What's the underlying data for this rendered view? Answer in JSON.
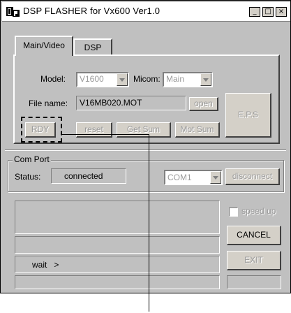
{
  "window": {
    "title": "DSP FLASHER for Vx600   Ver1.0",
    "minimize_glyph": "_",
    "maximize_glyph": "□",
    "close_glyph": "×",
    "app_icon": "dsp-app-icon"
  },
  "tabs": [
    {
      "label": "Main/Video",
      "active": true
    },
    {
      "label": "DSP",
      "active": false
    }
  ],
  "main": {
    "model_label": "Model:",
    "model_value": "V1600",
    "micom_label": "Micom:",
    "micom_value": "Main",
    "file_name_label": "File name:",
    "file_name_value": "V16MB020.MOT",
    "open_label": "open",
    "eps_label": "E.P.S",
    "rdy_label": "RDY",
    "reset_label": "reset",
    "get_sum_label": "Get Sum",
    "mot_sum_label": "Mot Sum"
  },
  "com_port": {
    "group_label": "Com Port",
    "status_label": "Status:",
    "status_value": "connected",
    "port_value": "COM1",
    "disconnect_label": "disconnect"
  },
  "log": {
    "wait_text": "wait   >"
  },
  "right_panel": {
    "speed_up_label": "speed up",
    "speed_up_checked": false,
    "cancel_label": "CANCEL",
    "exit_label": "EXIT"
  },
  "colors": {
    "face": "#c0c0c0",
    "disabled_text": "#9a9a9a",
    "highlight_box": "#000000"
  }
}
